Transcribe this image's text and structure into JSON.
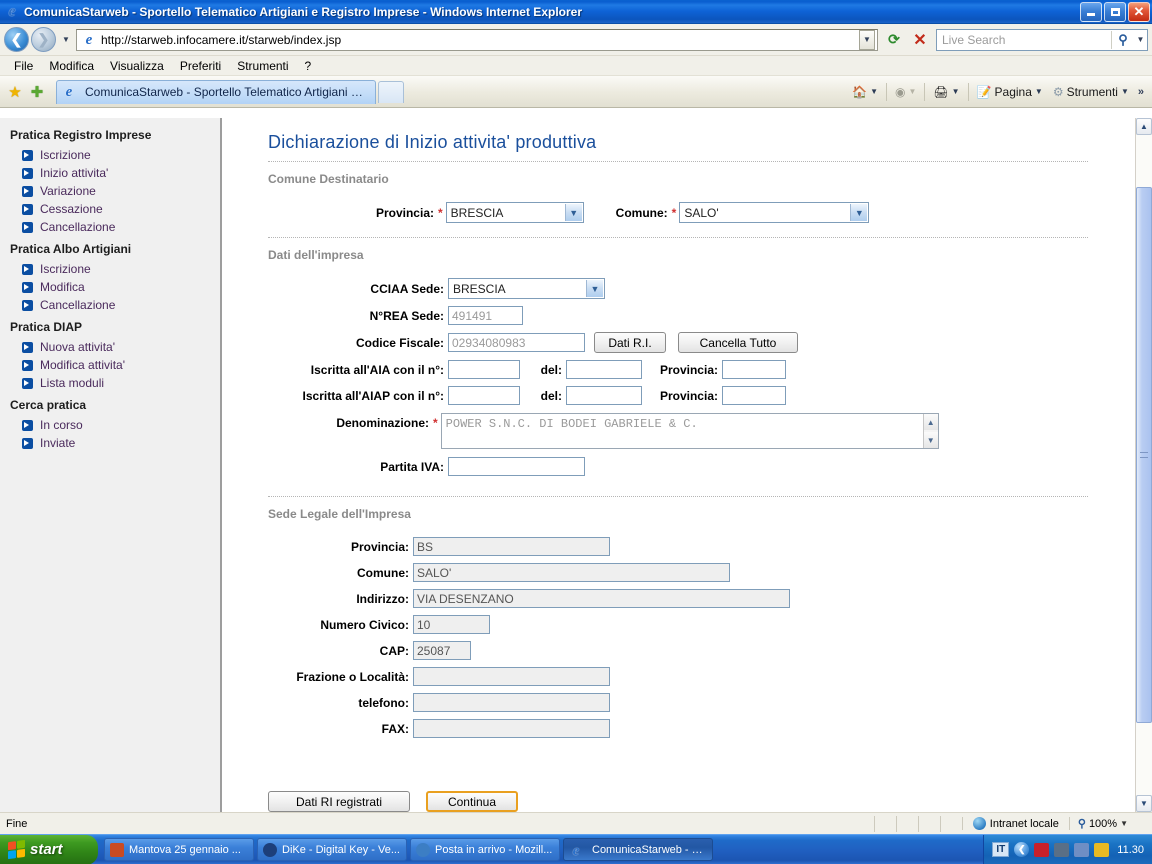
{
  "window": {
    "title": "ComunicaStarweb - Sportello Telematico Artigiani e Registro Imprese - Windows Internet Explorer",
    "minimize_label": "Riduci a icona",
    "maximize_label": "Ingrandisci",
    "close_label": "Chiudi"
  },
  "address_bar": {
    "url": "http://starweb.infocamere.it/starweb/index.jsp",
    "back_label": "Indietro",
    "forward_label": "Avanti",
    "history_label": "Cronologia",
    "refresh_label": "Aggiorna",
    "stop_label": "Interrompi",
    "go_label": "Vai"
  },
  "search": {
    "placeholder": "Live Search",
    "value": "",
    "search_label": "Cerca",
    "options_label": "Opzioni ricerca"
  },
  "menu": {
    "items": [
      {
        "label": "File"
      },
      {
        "label": "Modifica"
      },
      {
        "label": "Visualizza"
      },
      {
        "label": "Preferiti"
      },
      {
        "label": "Strumenti"
      },
      {
        "label": "?"
      }
    ]
  },
  "command_bar": {
    "favorites_label": "Centro preferiti",
    "add_favorite_label": "Aggiungi a Preferiti",
    "tab": {
      "label": "ComunicaStarweb - Sportello Telematico Artigiani e Re..."
    },
    "new_tab_label": "Nuova scheda",
    "home_label": "Pagina iniziale",
    "feeds_label": "Feed",
    "print_label": "Stampa",
    "page_label": "Pagina",
    "tools_label": "Strumenti",
    "overflow_label": "»"
  },
  "sidebar": {
    "groups": [
      {
        "title": "Pratica Registro Imprese",
        "items": [
          {
            "label": "Iscrizione"
          },
          {
            "label": "Inizio attivita'"
          },
          {
            "label": "Variazione"
          },
          {
            "label": "Cessazione"
          },
          {
            "label": "Cancellazione"
          }
        ]
      },
      {
        "title": "Pratica Albo Artigiani",
        "items": [
          {
            "label": "Iscrizione"
          },
          {
            "label": "Modifica"
          },
          {
            "label": "Cancellazione"
          }
        ]
      },
      {
        "title": "Pratica DIAP",
        "items": [
          {
            "label": "Nuova attivita'"
          },
          {
            "label": "Modifica attivita'"
          },
          {
            "label": "Lista moduli"
          }
        ]
      },
      {
        "title": "Cerca pratica",
        "items": [
          {
            "label": "In corso"
          },
          {
            "label": "Inviate"
          }
        ]
      }
    ]
  },
  "form": {
    "page_title": "Dichiarazione di Inizio attivita' produttiva",
    "section_comune": {
      "heading": "Comune Destinatario",
      "provincia_label": "Provincia:",
      "provincia_value": "BRESCIA",
      "comune_label": "Comune:",
      "comune_value": "SALO'",
      "required_mark": "*"
    },
    "section_impresa": {
      "heading": "Dati dell'impresa",
      "cciaa_label": "CCIAA Sede:",
      "cciaa_value": "BRESCIA",
      "rea_label": "N°REA Sede:",
      "rea_value": "491491",
      "cf_label": "Codice Fiscale:",
      "cf_value": "02934080983",
      "btn_dati_ri": "Dati R.I.",
      "btn_cancella": "Cancella Tutto",
      "aia_label": "Iscritta all'AIA con il n°:",
      "aia_value": "",
      "aia_del_label": "del:",
      "aia_del_value": "",
      "aia_prov_label": "Provincia:",
      "aia_prov_value": "",
      "aiap_label": "Iscritta all'AIAP con il n°:",
      "aiap_value": "",
      "aiap_del_label": "del:",
      "aiap_del_value": "",
      "aiap_prov_label": "Provincia:",
      "aiap_prov_value": "",
      "denominazione_label": "Denominazione:",
      "denominazione_value": "POWER S.N.C. DI BODEI GABRIELE & C.",
      "piva_label": "Partita IVA:",
      "piva_value": ""
    },
    "section_sede": {
      "heading": "Sede Legale dell'Impresa",
      "provincia_label": "Provincia:",
      "provincia_value": "BS",
      "comune_label": "Comune:",
      "comune_value": "SALO'",
      "indirizzo_label": "Indirizzo:",
      "indirizzo_value": "VIA DESENZANO",
      "civico_label": "Numero Civico:",
      "civico_value": "10",
      "cap_label": "CAP:",
      "cap_value": "25087",
      "frazione_label": "Frazione o Località:",
      "frazione_value": "",
      "telefono_label": "telefono:",
      "telefono_value": "",
      "fax_label": "FAX:",
      "fax_value": ""
    },
    "actions": {
      "btn_dati_ri_registrati": "Dati RI registrati",
      "btn_continua": "Continua"
    }
  },
  "status_bar": {
    "message": "Fine",
    "zone": "Intranet locale",
    "zoom": "100%"
  },
  "taskbar": {
    "start_label": "start",
    "tasks": [
      {
        "label": "Mantova 25 gennaio ...",
        "active": false
      },
      {
        "label": "DiKe - Digital Key - Ve...",
        "active": false
      },
      {
        "label": "Posta in arrivo - Mozill...",
        "active": false
      },
      {
        "label": "ComunicaStarweb - S...",
        "active": true
      }
    ],
    "tray": {
      "language": "IT",
      "time": "11.30"
    }
  }
}
